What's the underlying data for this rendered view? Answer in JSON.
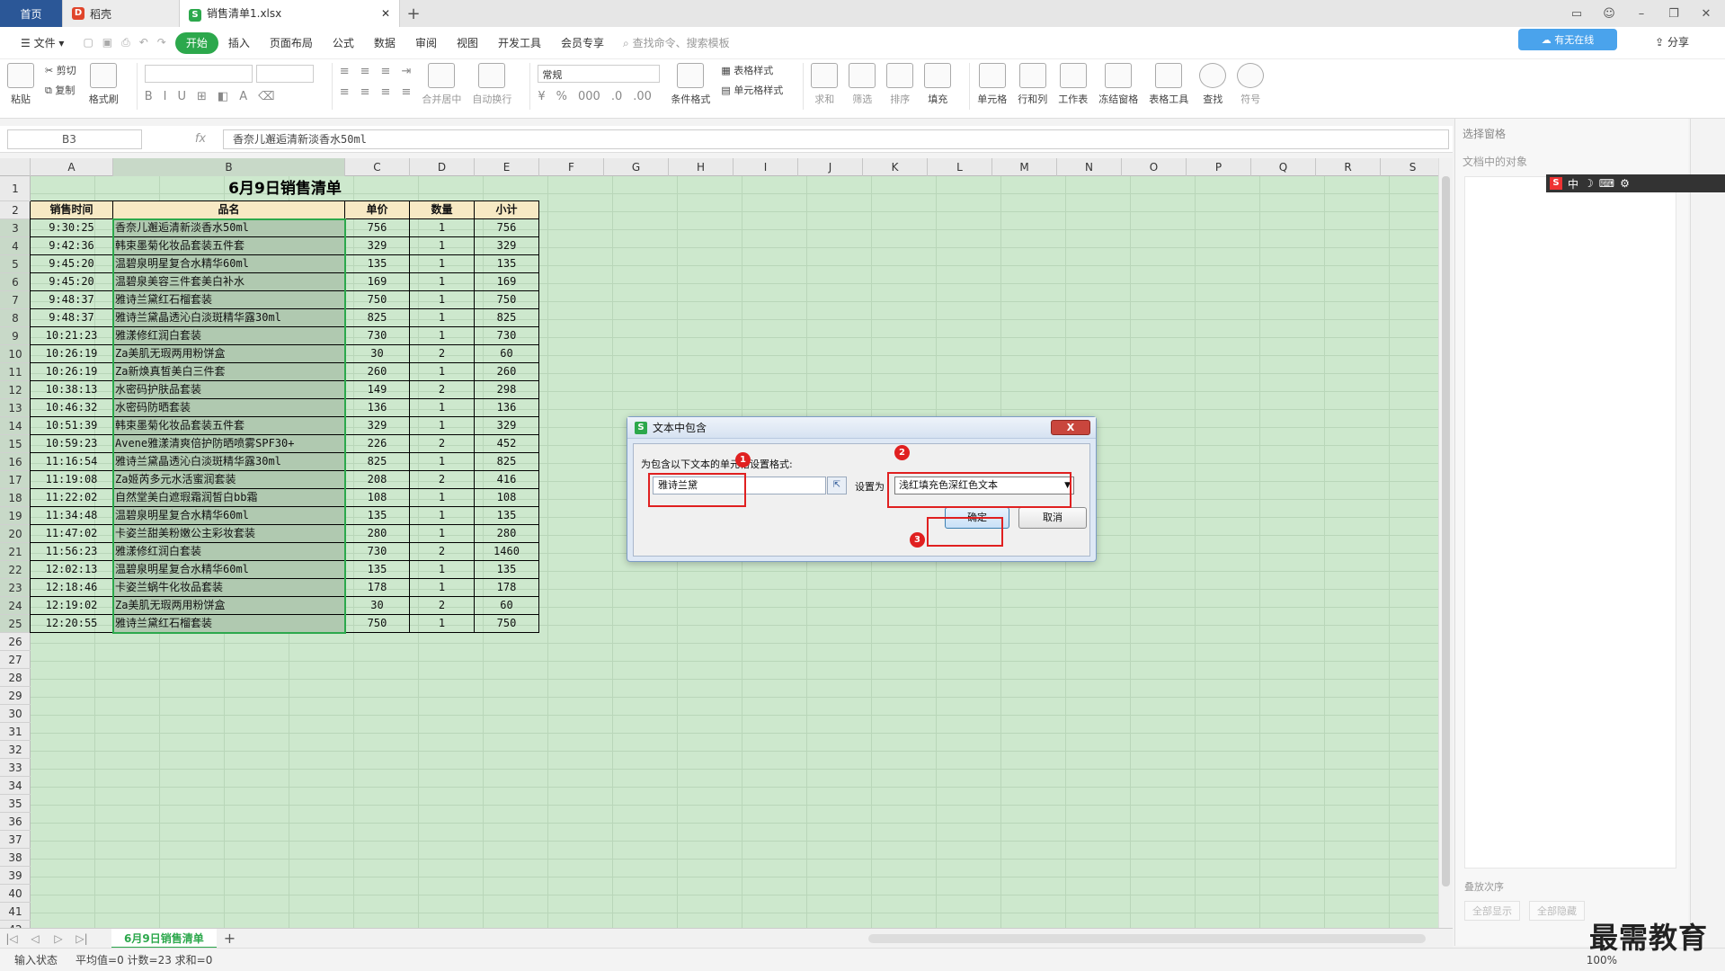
{
  "window": {
    "tabs": [
      {
        "label": "首页"
      },
      {
        "label": "稻壳"
      },
      {
        "label": "销售清单1.xlsx"
      }
    ]
  },
  "menu": {
    "file": "文件",
    "items": [
      "开始",
      "插入",
      "页面布局",
      "公式",
      "数据",
      "审阅",
      "视图",
      "开发工具",
      "会员专享"
    ],
    "search_placeholder": "查找命令、搜索模板",
    "cloud_btn": "有无在线",
    "share": "分享"
  },
  "ribbon": {
    "paste": "粘贴",
    "cut": "剪切",
    "copy": "复制",
    "format_painter": "格式刷",
    "merge_center": "合并居中",
    "auto_wrap": "自动换行",
    "number_format": "常规",
    "table_style": "表格样式",
    "cond_format": "条件格式",
    "cell_style": "单元格样式",
    "sum": "求和",
    "filter": "筛选",
    "sort": "排序",
    "fill": "填充",
    "cell": "单元格",
    "row_col": "行和列",
    "worksheet": "工作表",
    "freeze": "冻结窗格",
    "table_tools": "表格工具",
    "find": "查找",
    "symbol": "符号"
  },
  "formula_bar": {
    "name_box": "B3",
    "fx": "fx",
    "value": "香奈儿邂逅清新淡香水50ml"
  },
  "columns": [
    "A",
    "B",
    "C",
    "D",
    "E",
    "F",
    "G",
    "H",
    "I",
    "J",
    "K",
    "L",
    "M",
    "N",
    "O",
    "P",
    "Q",
    "R",
    "S"
  ],
  "sheet": {
    "title": "6月9日销售清单",
    "headers": [
      "销售时间",
      "品名",
      "单价",
      "数量",
      "小计"
    ],
    "rows": [
      [
        "9:30:25",
        "香奈儿邂逅清新淡香水50ml",
        "756",
        "1",
        "756"
      ],
      [
        "9:42:36",
        "韩束墨菊化妆品套装五件套",
        "329",
        "1",
        "329"
      ],
      [
        "9:45:20",
        "温碧泉明星复合水精华60ml",
        "135",
        "1",
        "135"
      ],
      [
        "9:45:20",
        "温碧泉美容三件套美白补水",
        "169",
        "1",
        "169"
      ],
      [
        "9:48:37",
        "雅诗兰黛红石榴套装",
        "750",
        "1",
        "750"
      ],
      [
        "9:48:37",
        "雅诗兰黛晶透沁白淡斑精华露30ml",
        "825",
        "1",
        "825"
      ],
      [
        "10:21:23",
        "雅漾修红润白套装",
        "730",
        "1",
        "730"
      ],
      [
        "10:26:19",
        "Za美肌无瑕两用粉饼盒",
        "30",
        "2",
        "60"
      ],
      [
        "10:26:19",
        "Za新焕真皙美白三件套",
        "260",
        "1",
        "260"
      ],
      [
        "10:38:13",
        "水密码护肤品套装",
        "149",
        "2",
        "298"
      ],
      [
        "10:46:32",
        "水密码防晒套装",
        "136",
        "1",
        "136"
      ],
      [
        "10:51:39",
        "韩束墨菊化妆品套装五件套",
        "329",
        "1",
        "329"
      ],
      [
        "10:59:23",
        "Avene雅漾清爽倍护防晒喷雾SPF30+",
        "226",
        "2",
        "452"
      ],
      [
        "11:16:54",
        "雅诗兰黛晶透沁白淡斑精华露30ml",
        "825",
        "1",
        "825"
      ],
      [
        "11:19:08",
        "Za姬芮多元水活蜜润套装",
        "208",
        "2",
        "416"
      ],
      [
        "11:22:02",
        "自然堂美白遮瑕霜润皙白bb霜",
        "108",
        "1",
        "108"
      ],
      [
        "11:34:48",
        "温碧泉明星复合水精华60ml",
        "135",
        "1",
        "135"
      ],
      [
        "11:47:02",
        "卡姿兰甜美粉嫩公主彩妆套装",
        "280",
        "1",
        "280"
      ],
      [
        "11:56:23",
        "雅漾修红润白套装",
        "730",
        "2",
        "1460"
      ],
      [
        "12:02:13",
        "温碧泉明星复合水精华60ml",
        "135",
        "1",
        "135"
      ],
      [
        "12:18:46",
        "卡姿兰蜗牛化妆品套装",
        "178",
        "1",
        "178"
      ],
      [
        "12:19:02",
        "Za美肌无瑕两用粉饼盒",
        "30",
        "2",
        "60"
      ],
      [
        "12:20:55",
        "雅诗兰黛红石榴套装",
        "750",
        "1",
        "750"
      ]
    ]
  },
  "sheet_tab": "6月9日销售清单",
  "status": {
    "mode": "输入状态",
    "summary": "平均值=0  计数=23  求和=0",
    "zoom": "100%"
  },
  "right_pane": {
    "title": "选择窗格",
    "subtitle": "文档中的对象",
    "order": "叠放次序",
    "show_all": "全部显示",
    "hide_all": "全部隐藏"
  },
  "dialog": {
    "title": "文本中包含",
    "prompt": "为包含以下文本的单元格设置格式:",
    "input_value": "雅诗兰黛",
    "set_label": "设置为",
    "format_option": "浅红填充色深红色文本",
    "ok": "确定",
    "cancel": "取消",
    "close": "X"
  },
  "annotations": [
    "1",
    "2",
    "3"
  ],
  "watermark": "最需教育"
}
